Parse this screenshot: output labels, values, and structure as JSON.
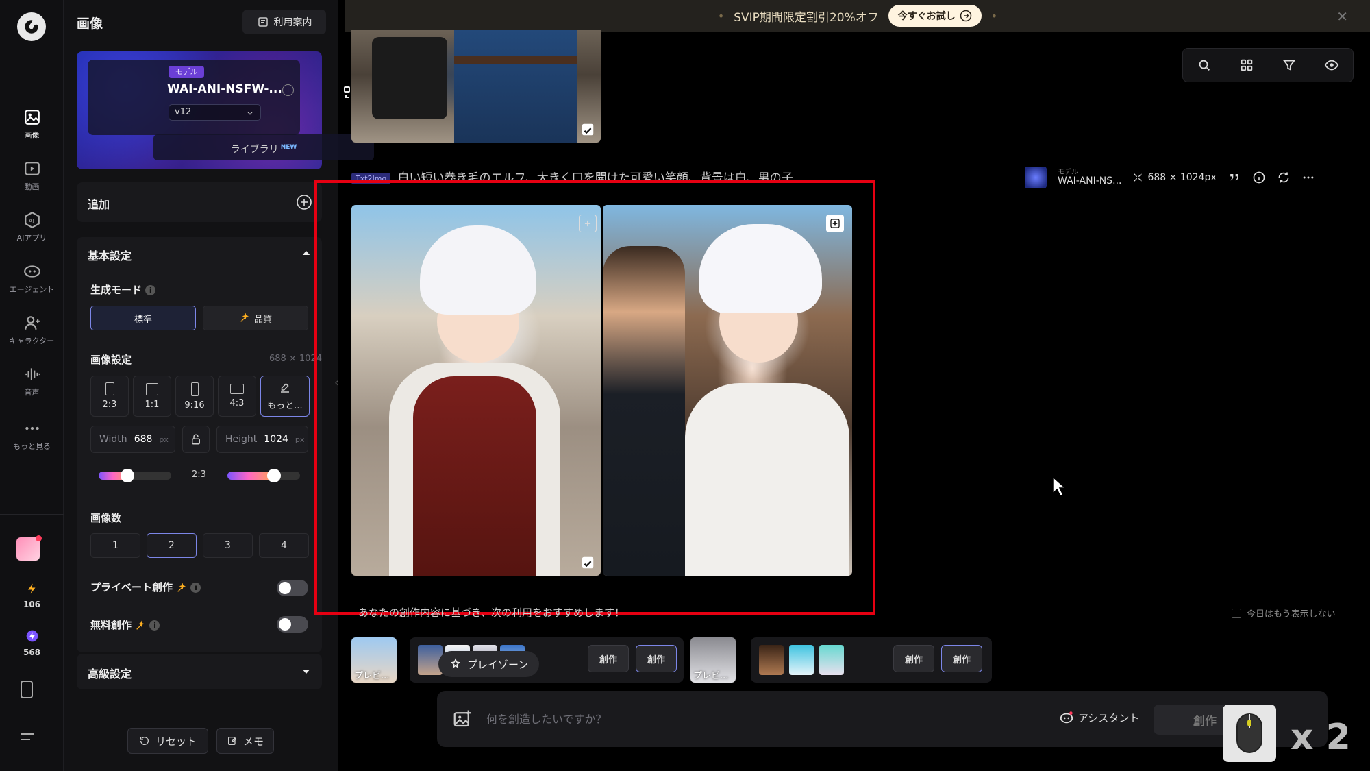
{
  "rail": {
    "items": [
      {
        "label": "画像"
      },
      {
        "label": "動画"
      },
      {
        "label": "AIアプリ"
      },
      {
        "label": "エージェント"
      },
      {
        "label": "キャラクター"
      },
      {
        "label": "音声"
      },
      {
        "label": "もっと見る"
      }
    ],
    "lightning_count": "106",
    "bolt_count": "568"
  },
  "panel": {
    "title": "画像",
    "guide_label": "利用案内",
    "model": {
      "tag": "モデル",
      "name": "WAI-ANI-NSFW-...",
      "version": "v12"
    },
    "library": {
      "label": "ライブラリ",
      "badge": "NEW"
    },
    "add_label": "追加",
    "basic_settings": "基本設定",
    "mode_label": "生成モード",
    "mode_standard": "標準",
    "mode_quality": "品質",
    "image_settings": "画像設定",
    "image_size": "688 × 1024",
    "ratios": [
      {
        "label": "2:3"
      },
      {
        "label": "1:1"
      },
      {
        "label": "9:16"
      },
      {
        "label": "4:3"
      },
      {
        "label": "もっと..."
      }
    ],
    "width": {
      "key": "Width",
      "value": "688",
      "unit": "px"
    },
    "height": {
      "key": "Height",
      "value": "1024",
      "unit": "px"
    },
    "slider_ratio": "2:3",
    "count_label": "画像数",
    "counts": [
      "1",
      "2",
      "3",
      "4"
    ],
    "selected_count": "2",
    "private_label": "プライベート創作",
    "free_label": "無料創作",
    "advanced_label": "高級設定",
    "reset_label": "リセット",
    "memo_label": "メモ"
  },
  "banner": {
    "text": "SVIP期間限定割引20%オフ",
    "cta": "今すぐお試し"
  },
  "main": {
    "prompt_tag": "Txt2Img",
    "prompt": "白い短い巻き毛のエルフ、大きく口を開けた可愛い笑顔、背景は白、男の子",
    "meta_model_small": "モデル",
    "meta_model_name": "WAI-ANI-NS...",
    "meta_size": "688 × 1024px",
    "recommend_text": "あなたの創作内容に基づき、次の利用をおすすめします！",
    "no_show_label": "今日はもう表示しない",
    "rec_caption": "プレビ...",
    "playzone_label": "プレイゾーン",
    "create_small": "創作",
    "input_placeholder": "何を創造したいですか？",
    "assistant_label": "アシスタント",
    "create_label": "創作",
    "x2_label": "x 2"
  },
  "colors": {
    "accent": "#7c86e8",
    "highlight": "#e60012",
    "banner_bg": "#24221e"
  }
}
